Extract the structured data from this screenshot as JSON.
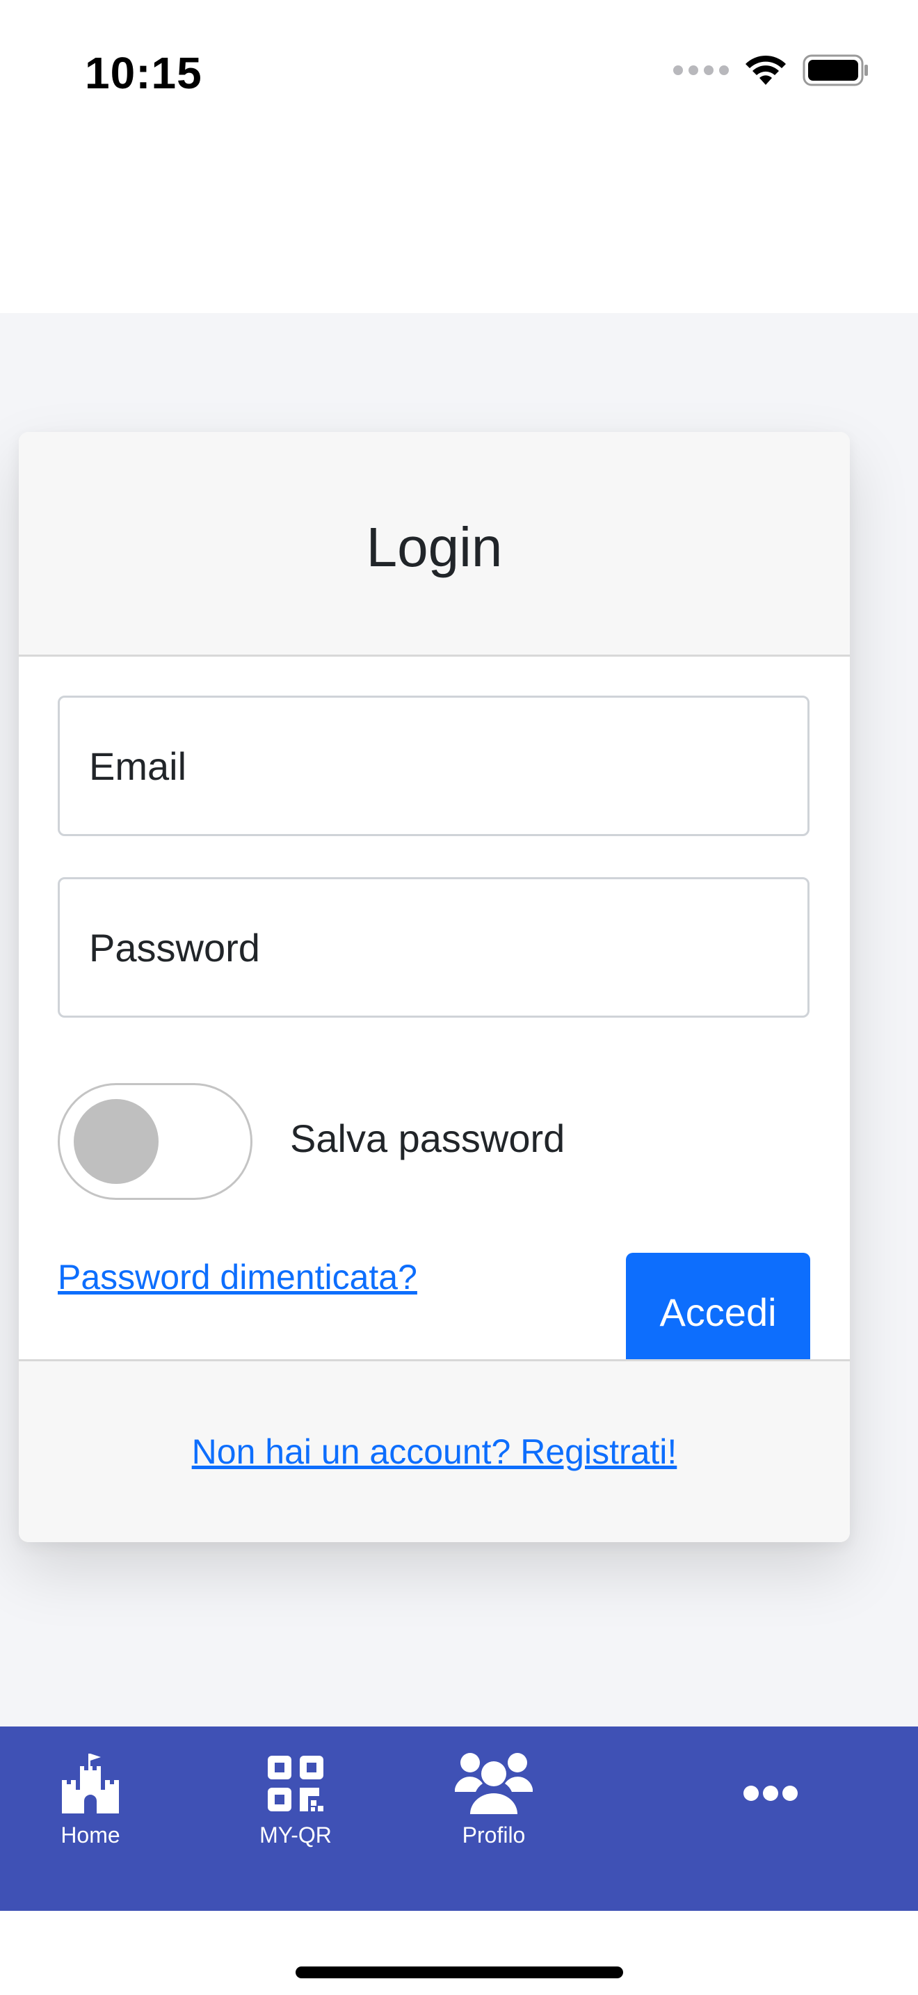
{
  "status_bar": {
    "time": "10:15"
  },
  "login_card": {
    "title": "Login",
    "email_placeholder": "Email",
    "password_placeholder": "Password",
    "save_password_label": "Salva password",
    "save_password_on": false,
    "forgot_password_link": "Password dimenticata?",
    "login_button": "Accedi",
    "register_link": "Non hai un account? Registrati!"
  },
  "tab_bar": {
    "items": [
      {
        "label": "Home",
        "icon": "castle-icon"
      },
      {
        "label": "MY-QR",
        "icon": "qr-code-icon"
      },
      {
        "label": "Profilo",
        "icon": "users-icon"
      },
      {
        "label": "",
        "icon": "more-icon"
      }
    ]
  },
  "colors": {
    "accent": "#0d6efd",
    "tab_bar": "#3f51b5",
    "background": "#f4f5f8"
  }
}
